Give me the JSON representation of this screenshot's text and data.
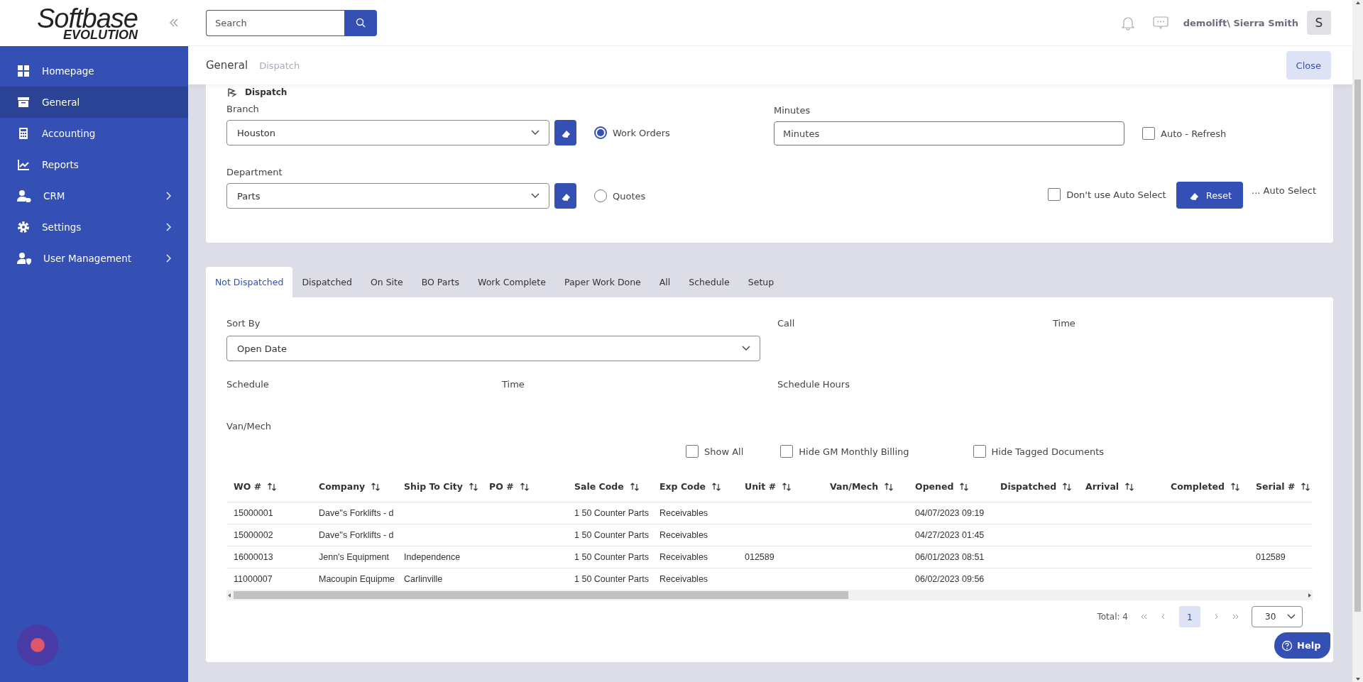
{
  "logo": {
    "name": "Softbase",
    "tagline": "EVOLUTION"
  },
  "sidebar": {
    "items": [
      {
        "label": "Homepage",
        "selected": false,
        "has_submenu": false
      },
      {
        "label": "General",
        "selected": true,
        "has_submenu": false
      },
      {
        "label": "Accounting",
        "selected": false,
        "has_submenu": false
      },
      {
        "label": "Reports",
        "selected": false,
        "has_submenu": false
      },
      {
        "label": "CRM",
        "selected": false,
        "has_submenu": true
      },
      {
        "label": "Settings",
        "selected": false,
        "has_submenu": true
      },
      {
        "label": "User Management",
        "selected": false,
        "has_submenu": true
      }
    ]
  },
  "header": {
    "search": {
      "placeholder": "Search"
    },
    "user": "demolift\\ Sierra Smith",
    "avatar": "S"
  },
  "breadcrumb": [
    {
      "label": "General",
      "current": true
    },
    {
      "label": "Dispatch",
      "current": false
    }
  ],
  "close_button": "Close",
  "dispatch": {
    "title": "Dispatch",
    "branch": {
      "label": "Branch",
      "value": "Houston"
    },
    "department": {
      "label": "Department",
      "value": "Parts"
    },
    "doc_types": [
      {
        "label": "Work Orders",
        "selected": true
      },
      {
        "label": "Quotes",
        "selected": false
      }
    ],
    "minutes": {
      "label": "Minutes",
      "placeholder": "Minutes"
    },
    "auto_refresh": {
      "label": "Auto - Refresh",
      "checked": false
    },
    "no_auto_select": {
      "label": "Don't use Auto Select",
      "checked": false
    },
    "reset_button": "Reset",
    "auto_select_link": "... Auto Select"
  },
  "tabs": [
    {
      "label": "Not Dispatched",
      "selected": true
    },
    {
      "label": "Dispatched",
      "selected": false
    },
    {
      "label": "On Site",
      "selected": false
    },
    {
      "label": "BO Parts",
      "selected": false
    },
    {
      "label": "Work Complete",
      "selected": false
    },
    {
      "label": "Paper Work Done",
      "selected": false
    },
    {
      "label": "All",
      "selected": false
    },
    {
      "label": "Schedule",
      "selected": false
    },
    {
      "label": "Setup",
      "selected": false
    }
  ],
  "filters": {
    "lines": [
      [
        {
          "kind": "select",
          "label": "Sort By",
          "value": "Open Date"
        },
        {
          "kind": "label",
          "label": "Call"
        },
        {
          "kind": "label",
          "label": "Time"
        }
      ],
      [
        {
          "kind": "label",
          "label": "Schedule"
        },
        {
          "kind": "label",
          "label": "Time"
        },
        {
          "kind": "label",
          "label": "Schedule Hours"
        }
      ],
      [
        {
          "kind": "label",
          "label": "Van/Mech"
        }
      ]
    ]
  },
  "options": [
    {
      "label": "Show All",
      "checked": false
    },
    {
      "label": "Hide GM Monthly Billing",
      "checked": false
    },
    {
      "label": "Hide Tagged Documents",
      "checked": false
    }
  ],
  "table": {
    "columns": [
      "WO #",
      "Company",
      "Ship To City",
      "PO #",
      "Sale Code",
      "Exp Code",
      "Unit #",
      "Van/Mech",
      "Opened",
      "Dispatched",
      "Arrival",
      "Completed",
      "Serial #"
    ],
    "rows": [
      [
        "15000001",
        "Dave''s Forklifts - d",
        "",
        "",
        "1 50 Counter Parts",
        "Receivables",
        "",
        "",
        "04/07/2023 09:19",
        "",
        "",
        "",
        ""
      ],
      [
        "15000002",
        "Dave''s Forklifts - d",
        "",
        "",
        "1 50 Counter Parts",
        "Receivables",
        "",
        "",
        "04/27/2023 01:45",
        "",
        "",
        "",
        ""
      ],
      [
        "16000013",
        "Jenn's Equipment",
        "Independence",
        "",
        "1 50 Counter Parts",
        "Receivables",
        "012589",
        "",
        "06/01/2023 08:51",
        "",
        "",
        "",
        "012589"
      ],
      [
        "11000007",
        "Macoupin Equipme",
        "Carlinville",
        "",
        "1 50 Counter Parts",
        "Receivables",
        "",
        "",
        "06/02/2023 09:56",
        "",
        "",
        "",
        ""
      ]
    ]
  },
  "pagination": {
    "total": "Total: 4",
    "pages": [
      {
        "label": "1",
        "selected": true
      }
    ],
    "page_size": "30"
  },
  "help_button": "Help"
}
